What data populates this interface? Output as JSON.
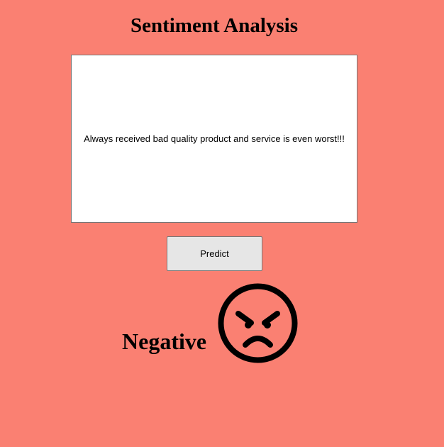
{
  "page": {
    "title": "Sentiment Analysis"
  },
  "input": {
    "value": "Always received bad quality product and service is even worst!!!"
  },
  "actions": {
    "predict_label": "Predict"
  },
  "result": {
    "label": "Negative",
    "icon": "angry-face-icon"
  },
  "colors": {
    "background": "#fa8072",
    "text_box": "#ffffff",
    "button": "#e6e6e6"
  }
}
